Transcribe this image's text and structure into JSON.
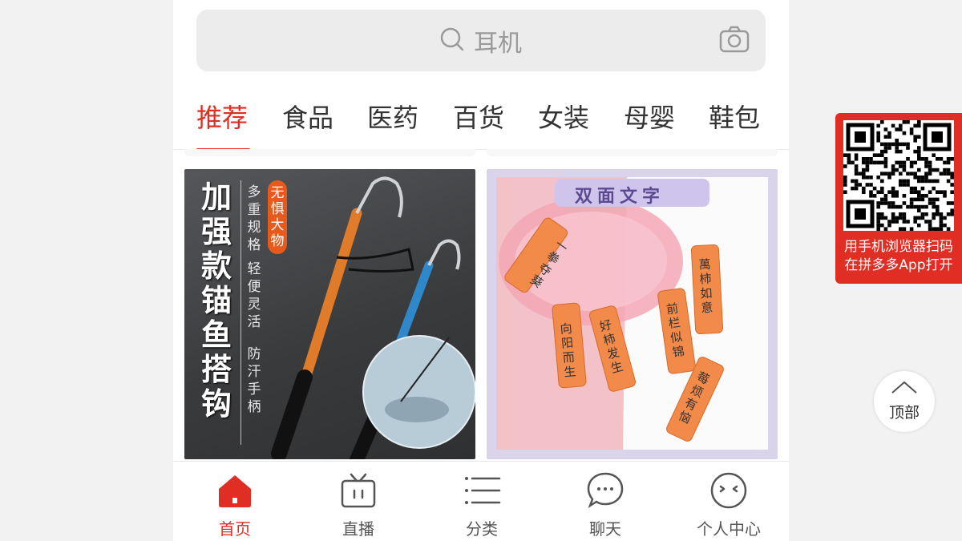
{
  "search": {
    "placeholder": "耳机"
  },
  "tabs": [
    {
      "label": "推荐"
    },
    {
      "label": "食品"
    },
    {
      "label": "医药"
    },
    {
      "label": "百货"
    },
    {
      "label": "女装"
    },
    {
      "label": "母婴"
    },
    {
      "label": "鞋包"
    }
  ],
  "products": [
    {
      "title": "加强款锚鱼搭钩",
      "subtitle_1": "多重规格",
      "subtitle_2": "轻便灵活",
      "subtitle_3": "防汗手柄",
      "badge": "无惧大物"
    },
    {
      "title": "双面文字",
      "tag_1": "一拳夺葵",
      "tag_2": "向阳而生",
      "tag_3": "好柿发生",
      "tag_4": "前栏似锦",
      "tag_5": "萬柿如意",
      "tag_6": "莓烦有恼"
    }
  ],
  "nav": [
    {
      "label": "首页"
    },
    {
      "label": "直播"
    },
    {
      "label": "分类"
    },
    {
      "label": "聊天"
    },
    {
      "label": "个人中心"
    }
  ],
  "qr": {
    "line1": "用手机浏览器扫码",
    "line2": "在拼多多App打开"
  },
  "back_to_top": {
    "label": "顶部"
  },
  "colors": {
    "accent": "#e02e24",
    "text": "#333333",
    "search_bg": "#ececec"
  }
}
